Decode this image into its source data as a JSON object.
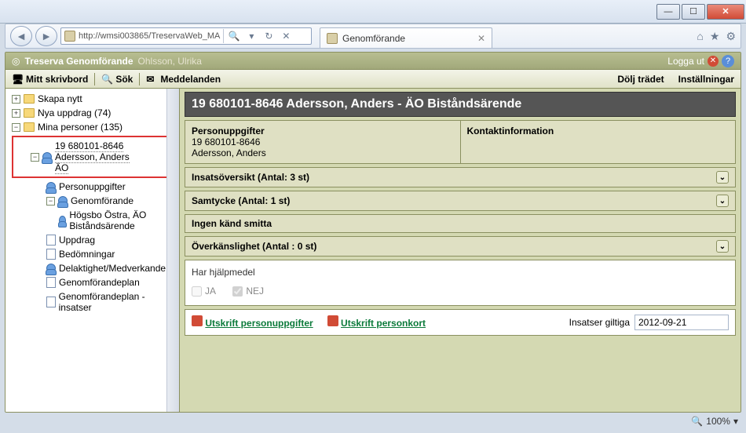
{
  "browser": {
    "url": "http://wmsi003865/TreservaWeb_MA",
    "tab_title": "Genomförande",
    "zoom": "100%"
  },
  "app": {
    "title": "Treserva Genomförande",
    "user": "Ohlsson, Ulrika",
    "logout": "Logga ut"
  },
  "toolbar": {
    "desktop": "Mitt skrivbord",
    "search": "Sök",
    "messages": "Meddelanden",
    "hide_tree": "Dölj trädet",
    "settings": "Inställningar"
  },
  "tree": {
    "create_new": "Skapa nytt",
    "new_assignments": "Nya uppdrag (74)",
    "my_persons": "Mina personer (135)",
    "person": {
      "line1": "19 680101-8646",
      "line2": "Adersson, Anders",
      "line3": "ÄO"
    },
    "nodes": {
      "personuppgifter": "Personuppgifter",
      "genomforande": "Genomförande",
      "sub_bistand": "Högsbo Östra, ÄO Biståndsärende",
      "uppdrag": "Uppdrag",
      "bedomningar": "Bedömningar",
      "delaktighet": "Delaktighet/Medverkande",
      "genplan": "Genomförandeplan",
      "genplan_insatser": "Genomförandeplan - insatser"
    }
  },
  "page": {
    "title": "19 680101-8646 Adersson, Anders - ÄO Biståndsärende",
    "personuppgifter": {
      "heading": "Personuppgifter",
      "pnr": "19 680101-8646",
      "name": "Adersson, Anders"
    },
    "kontakt_heading": "Kontaktinformation",
    "sections": {
      "insats": "Insatsöversikt (Antal: 3 st)",
      "samtycke": "Samtycke (Antal: 1 st)",
      "smitta": "Ingen känd smitta",
      "overkanslighet": "Överkänslighet (Antal : 0 st)"
    },
    "hjalpmedel": {
      "label": "Har hjälpmedel",
      "ja": "JA",
      "nej": "NEJ"
    },
    "bottom": {
      "print_person": "Utskrift personuppgifter",
      "print_kort": "Utskrift personkort",
      "valid_label": "Insatser giltiga",
      "valid_date": "2012-09-21"
    }
  }
}
